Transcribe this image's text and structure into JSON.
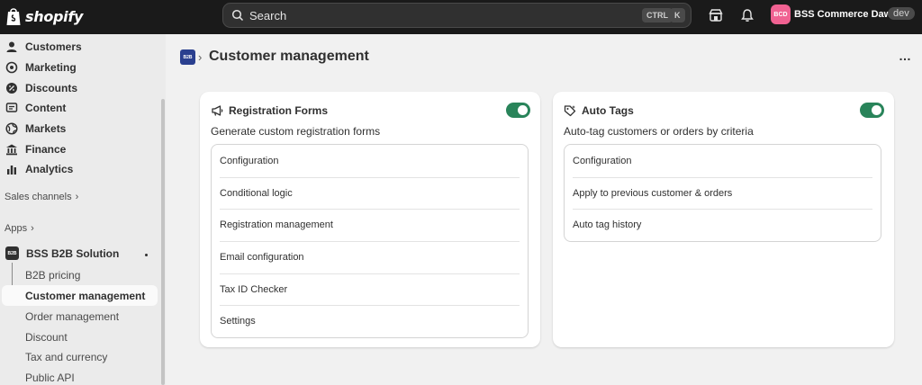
{
  "topbar": {
    "logo_text": "shopify",
    "search_placeholder": "Search",
    "shortcut_ctrl": "CTRL",
    "shortcut_k": "K",
    "store_initials": "BCD",
    "store_name": "BSS Commerce Dawn",
    "env_tag": "dev"
  },
  "sidebar": {
    "nav": [
      {
        "label": "Customers",
        "icon": "person-icon"
      },
      {
        "label": "Marketing",
        "icon": "target-icon"
      },
      {
        "label": "Discounts",
        "icon": "discount-icon"
      },
      {
        "label": "Content",
        "icon": "content-icon"
      },
      {
        "label": "Markets",
        "icon": "globe-icon"
      },
      {
        "label": "Finance",
        "icon": "bank-icon"
      },
      {
        "label": "Analytics",
        "icon": "bar-chart-icon"
      }
    ],
    "sales_channels": "Sales channels",
    "apps": "Apps",
    "app_name": "BSS B2B Solution",
    "app_logo_text": "B2B",
    "sub_items": [
      "B2B pricing",
      "Customer management",
      "Order management",
      "Discount",
      "Tax and currency",
      "Public API"
    ]
  },
  "page": {
    "breadcrumb_logo": "B2B",
    "title": "Customer management",
    "more": "…"
  },
  "registration": {
    "title": "Registration Forms",
    "enabled": true,
    "description": "Generate custom registration forms",
    "items": [
      "Configuration",
      "Conditional logic",
      "Registration management",
      "Email configuration",
      "Tax ID Checker",
      "Settings"
    ]
  },
  "auto_tags": {
    "title": "Auto Tags",
    "enabled": true,
    "description": "Auto-tag customers or orders by criteria",
    "items": [
      "Configuration",
      "Apply to previous customer & orders",
      "Auto tag history"
    ]
  },
  "colors": {
    "topbar": "#1a1a1a",
    "toggle_on": "#29845a",
    "store_badge": "#f06292"
  }
}
